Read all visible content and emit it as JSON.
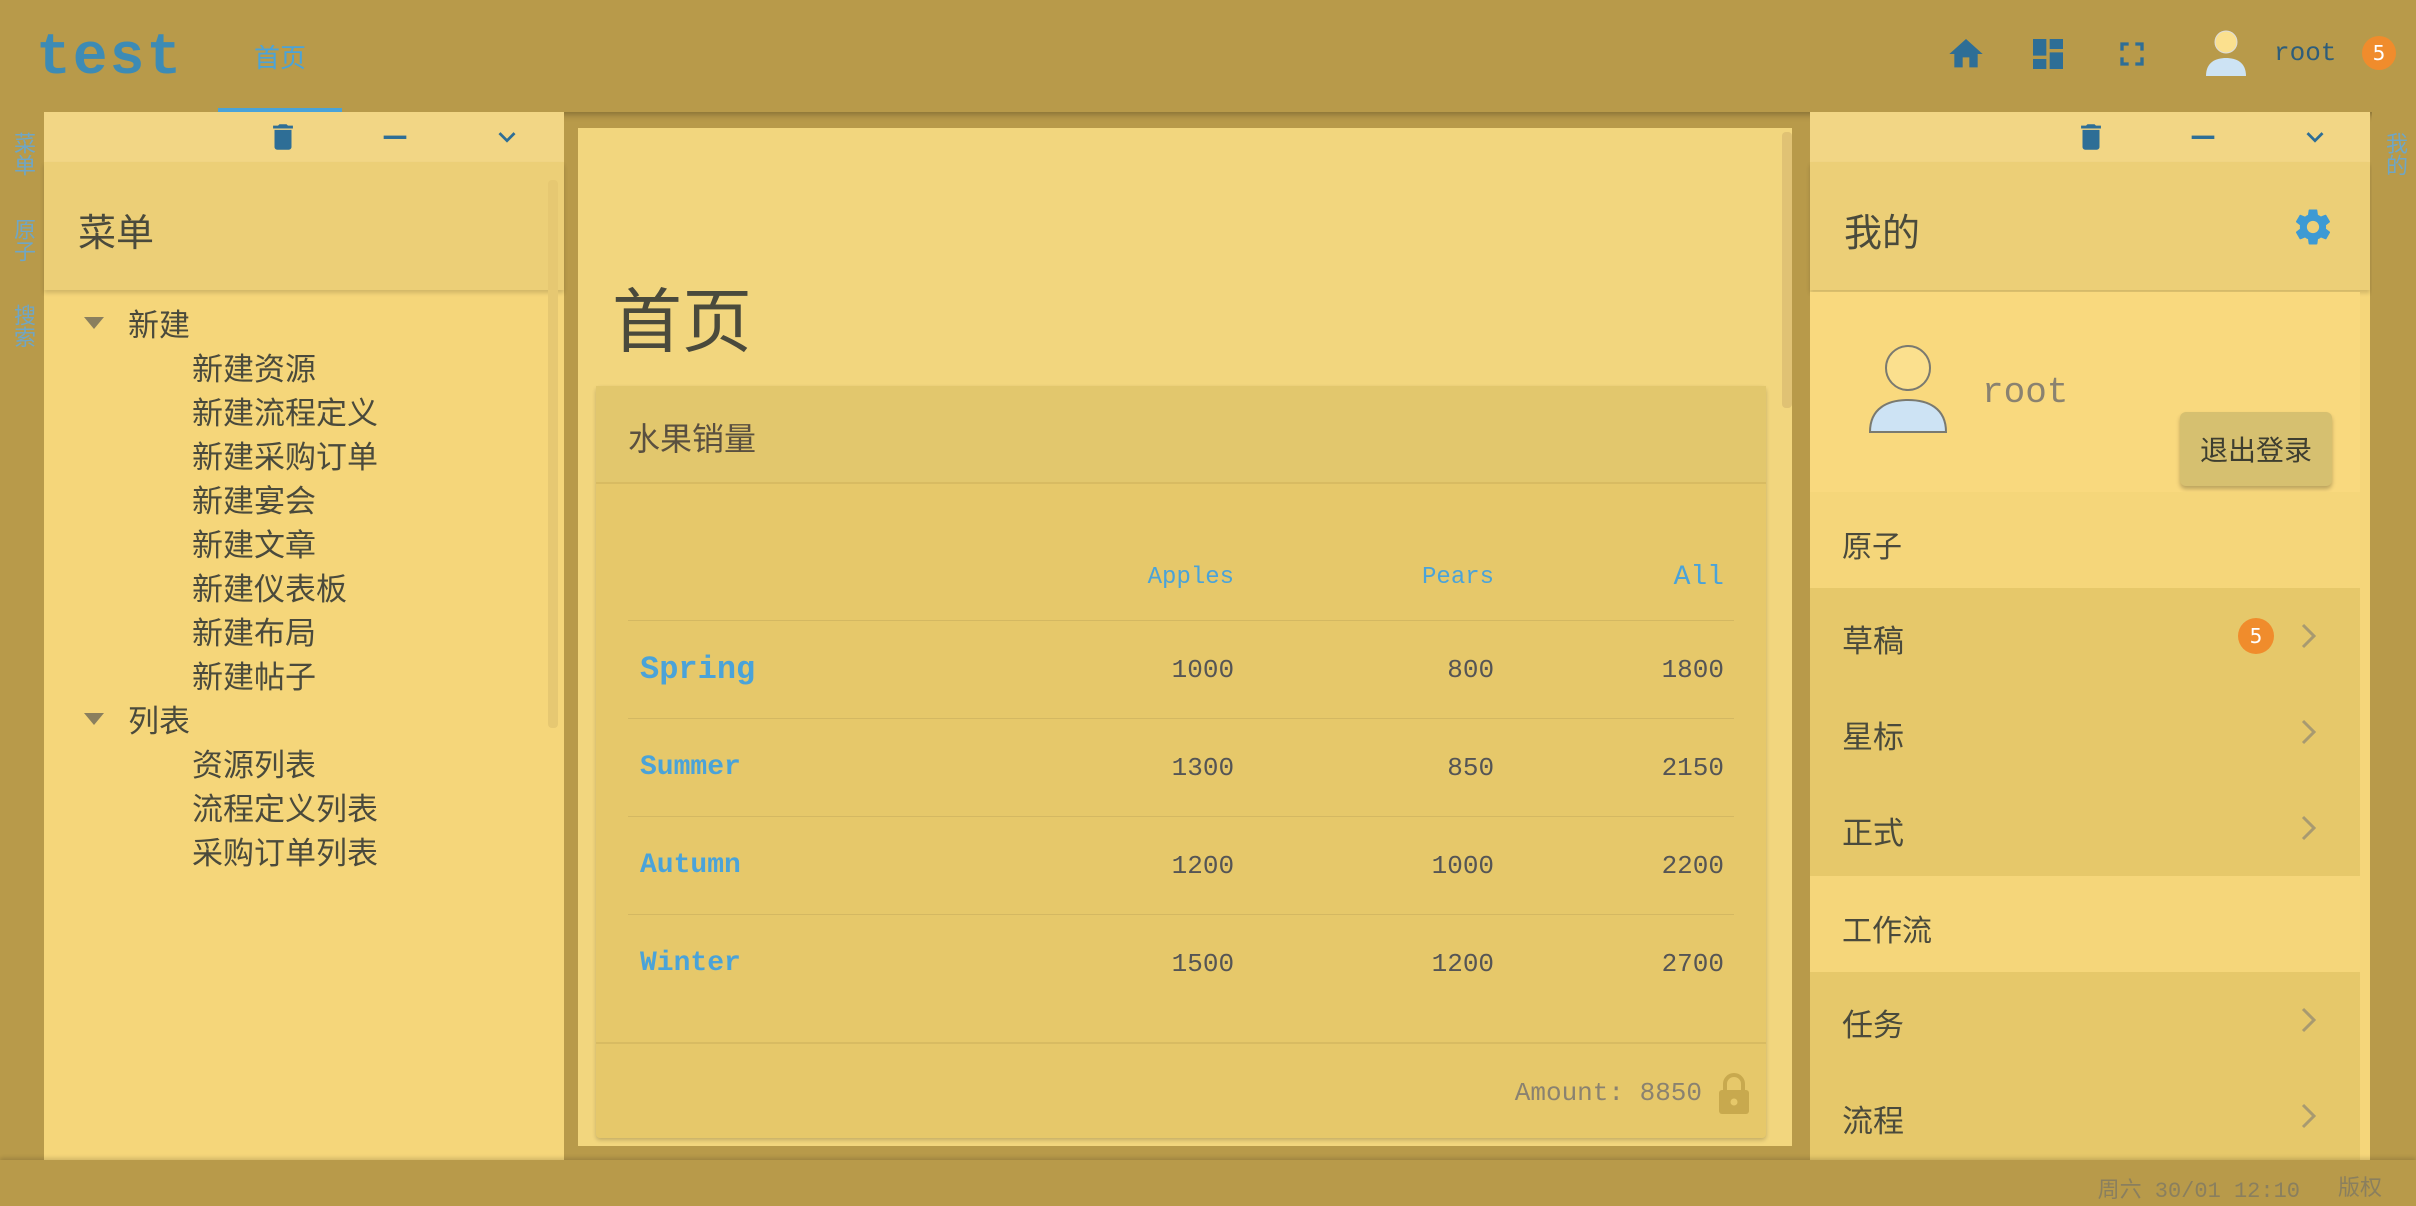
{
  "header": {
    "logo": "test",
    "tab_home": "首页",
    "user_name": "root",
    "notification_count": "5",
    "icons": [
      "home-icon",
      "dashboard-icon",
      "fullscreen-icon",
      "avatar-icon"
    ]
  },
  "left_rail": [
    "菜单",
    "原子",
    "搜索"
  ],
  "right_rail": [
    "我的"
  ],
  "menu_panel": {
    "title": "菜单",
    "groups": [
      {
        "label": "新建",
        "items": [
          "新建资源",
          "新建流程定义",
          "新建采购订单",
          "新建宴会",
          "新建文章",
          "新建仪表板",
          "新建布局",
          "新建帖子"
        ]
      },
      {
        "label": "列表",
        "items": [
          "资源列表",
          "流程定义列表",
          "采购订单列表"
        ]
      }
    ]
  },
  "main": {
    "page_title": "首页",
    "card": {
      "title": "水果销量",
      "columns": [
        "",
        "Apples",
        "Pears",
        "All"
      ],
      "rows": [
        {
          "season": "Spring",
          "apples": "1000",
          "pears": "800",
          "all": "1800"
        },
        {
          "season": "Summer",
          "apples": "1300",
          "pears": "850",
          "all": "2150"
        },
        {
          "season": "Autumn",
          "apples": "1200",
          "pears": "1000",
          "all": "2200"
        },
        {
          "season": "Winter",
          "apples": "1500",
          "pears": "1200",
          "all": "2700"
        }
      ],
      "footer": "Amount: 8850"
    }
  },
  "mine_panel": {
    "title": "我的",
    "user_name": "root",
    "logout_label": "退出登录",
    "sections": [
      {
        "heading": "原子",
        "items": [
          {
            "label": "草稿",
            "badge": "5"
          },
          {
            "label": "星标"
          },
          {
            "label": "正式"
          }
        ]
      },
      {
        "heading": "工作流",
        "items": [
          {
            "label": "任务"
          },
          {
            "label": "流程"
          }
        ]
      }
    ]
  },
  "footer": {
    "clock": "周六 30/01 12:10",
    "copyright": "版权"
  },
  "colors": {
    "background": "#b89a4a",
    "panel": "#f5d67a",
    "accent": "#4aa3d9",
    "badge": "#f08c2c"
  }
}
